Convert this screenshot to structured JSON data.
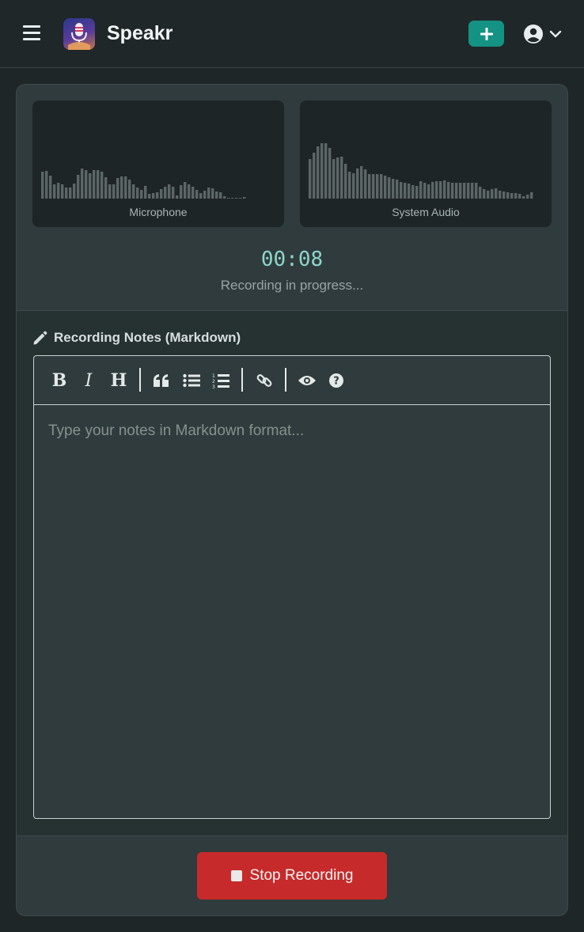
{
  "header": {
    "title": "Speakr",
    "new_button_icon": "plus-icon",
    "user_icon": "user-circle-icon"
  },
  "visualizers": [
    {
      "label": "Microphone"
    },
    {
      "label": "System Audio"
    }
  ],
  "recording": {
    "timer": "00:08",
    "status": "Recording in progress..."
  },
  "notes": {
    "label": "Recording Notes (Markdown)",
    "placeholder": "Type your notes in Markdown format...",
    "toolbar": [
      "bold",
      "italic",
      "heading",
      "quote",
      "unordered-list",
      "ordered-list",
      "link",
      "preview",
      "guide"
    ]
  },
  "actions": {
    "stop_label": "Stop Recording"
  },
  "colors": {
    "accent": "#149283",
    "danger": "#c62a2a",
    "timer": "#8fd6cd"
  }
}
